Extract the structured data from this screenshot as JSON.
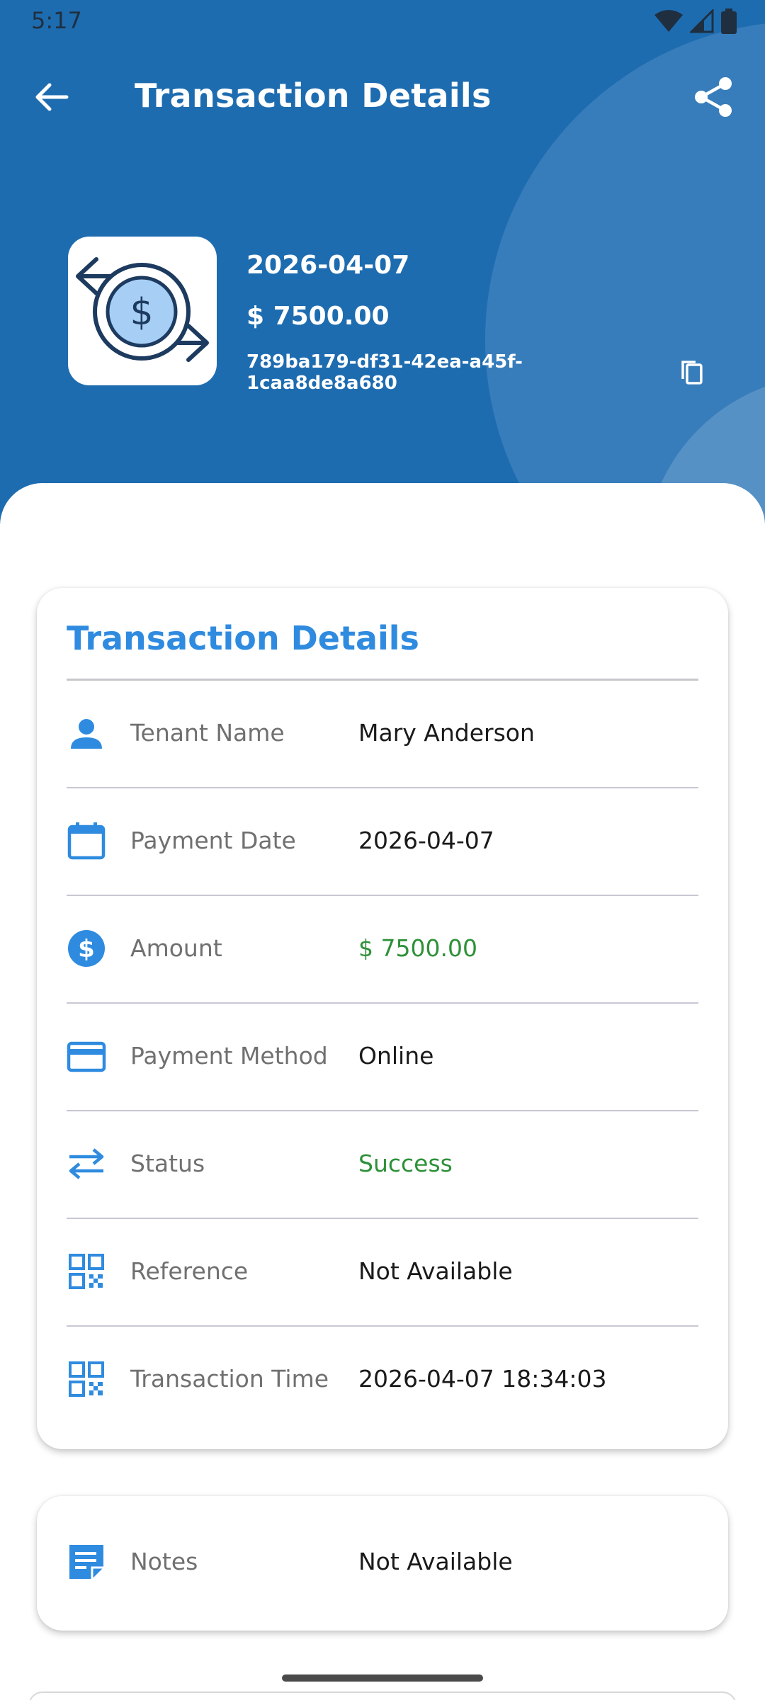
{
  "status_bar": {
    "time": "5:17"
  },
  "appbar": {
    "title": "Transaction Details"
  },
  "summary": {
    "date": "2026-04-07",
    "amount": "$ 7500.00",
    "transaction_id": "789ba179-df31-42ea-a45f-1caa8de8a680"
  },
  "details_card": {
    "title": "Transaction Details",
    "rows": [
      {
        "icon": "person-icon",
        "label": "Tenant Name",
        "value": "Mary Anderson"
      },
      {
        "icon": "calendar-icon",
        "label": "Payment Date",
        "value": "2026-04-07"
      },
      {
        "icon": "dollar-icon",
        "label": "Amount",
        "value": "$ 7500.00"
      },
      {
        "icon": "credit-card-icon",
        "label": "Payment Method",
        "value": "Online"
      },
      {
        "icon": "swap-arrows-icon",
        "label": "Status",
        "value": "Success"
      },
      {
        "icon": "qr-code-icon",
        "label": "Reference",
        "value": "Not Available"
      },
      {
        "icon": "qr-code-icon",
        "label": "Transaction Time",
        "value": "2026-04-07 18:34:03"
      }
    ]
  },
  "notes_card": {
    "icon": "note-icon",
    "label": "Notes",
    "value": "Not Available"
  },
  "colors": {
    "header_bg": "#1e6cb0",
    "accent_blue": "#2f8bdf",
    "success_green": "#2e9138",
    "label_gray": "#707070"
  }
}
